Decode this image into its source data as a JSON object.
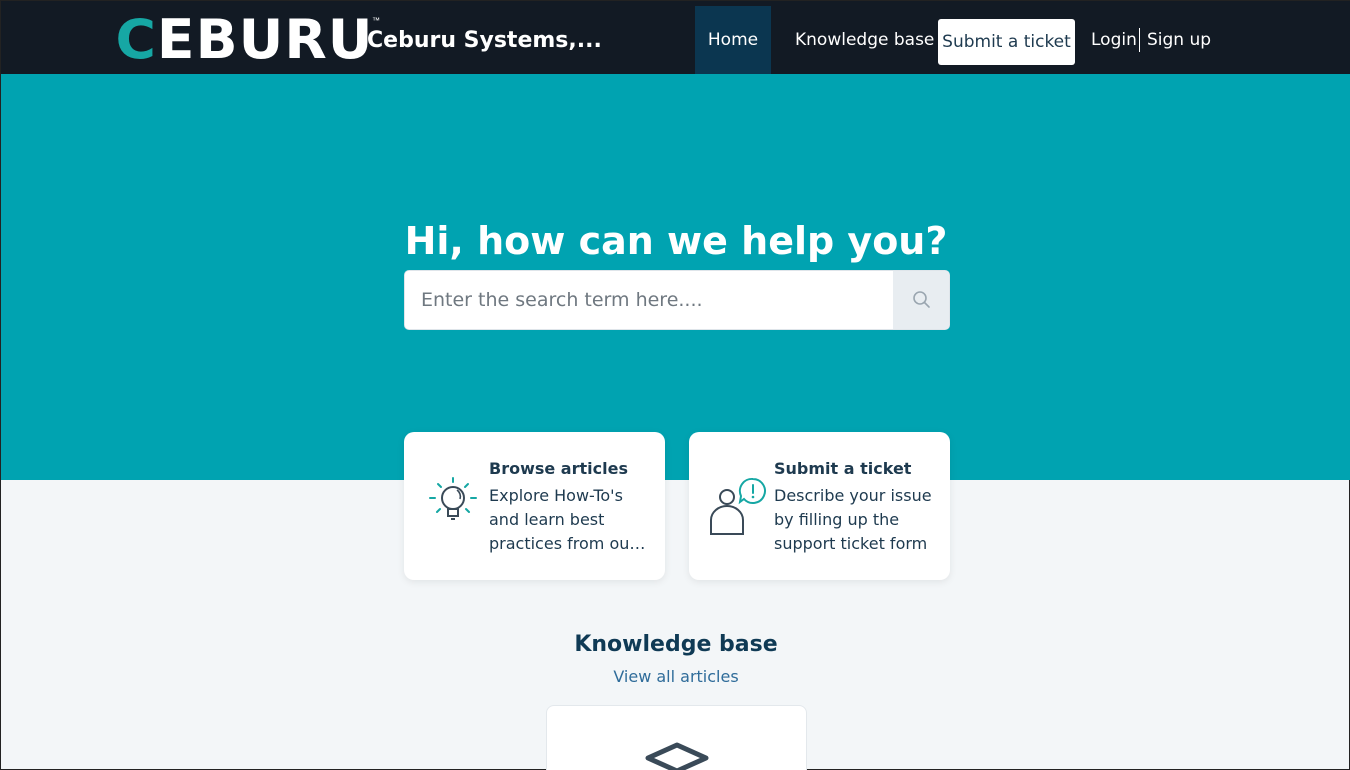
{
  "header": {
    "logo_text_accent": "C",
    "logo_text_rest": "EBURU",
    "logo_tm": "™",
    "company_name": "Ceburu Systems,...",
    "nav": {
      "home": "Home",
      "knowledge_base": "Knowledge base",
      "submit_ticket": "Submit a ticket",
      "login": "Login",
      "signup": "Sign up"
    }
  },
  "hero": {
    "title": "Hi, how can we help you?",
    "search_placeholder": "Enter the search term here...."
  },
  "cards": [
    {
      "title": "Browse articles",
      "description": "Explore How-To's and learn best practices from our knowledge base",
      "icon": "lightbulb-icon"
    },
    {
      "title": "Submit a ticket",
      "description": "Describe your issue by filling up the support ticket form",
      "icon": "person-alert-icon"
    }
  ],
  "knowledge_base": {
    "title": "Knowledge base",
    "view_all": "View all articles",
    "icon": "diamond-icon"
  },
  "colors": {
    "header_bg": "#121a24",
    "hero_bg": "#00a3b1",
    "accent": "#16a7a4",
    "active_nav_bg": "#0b3650"
  }
}
